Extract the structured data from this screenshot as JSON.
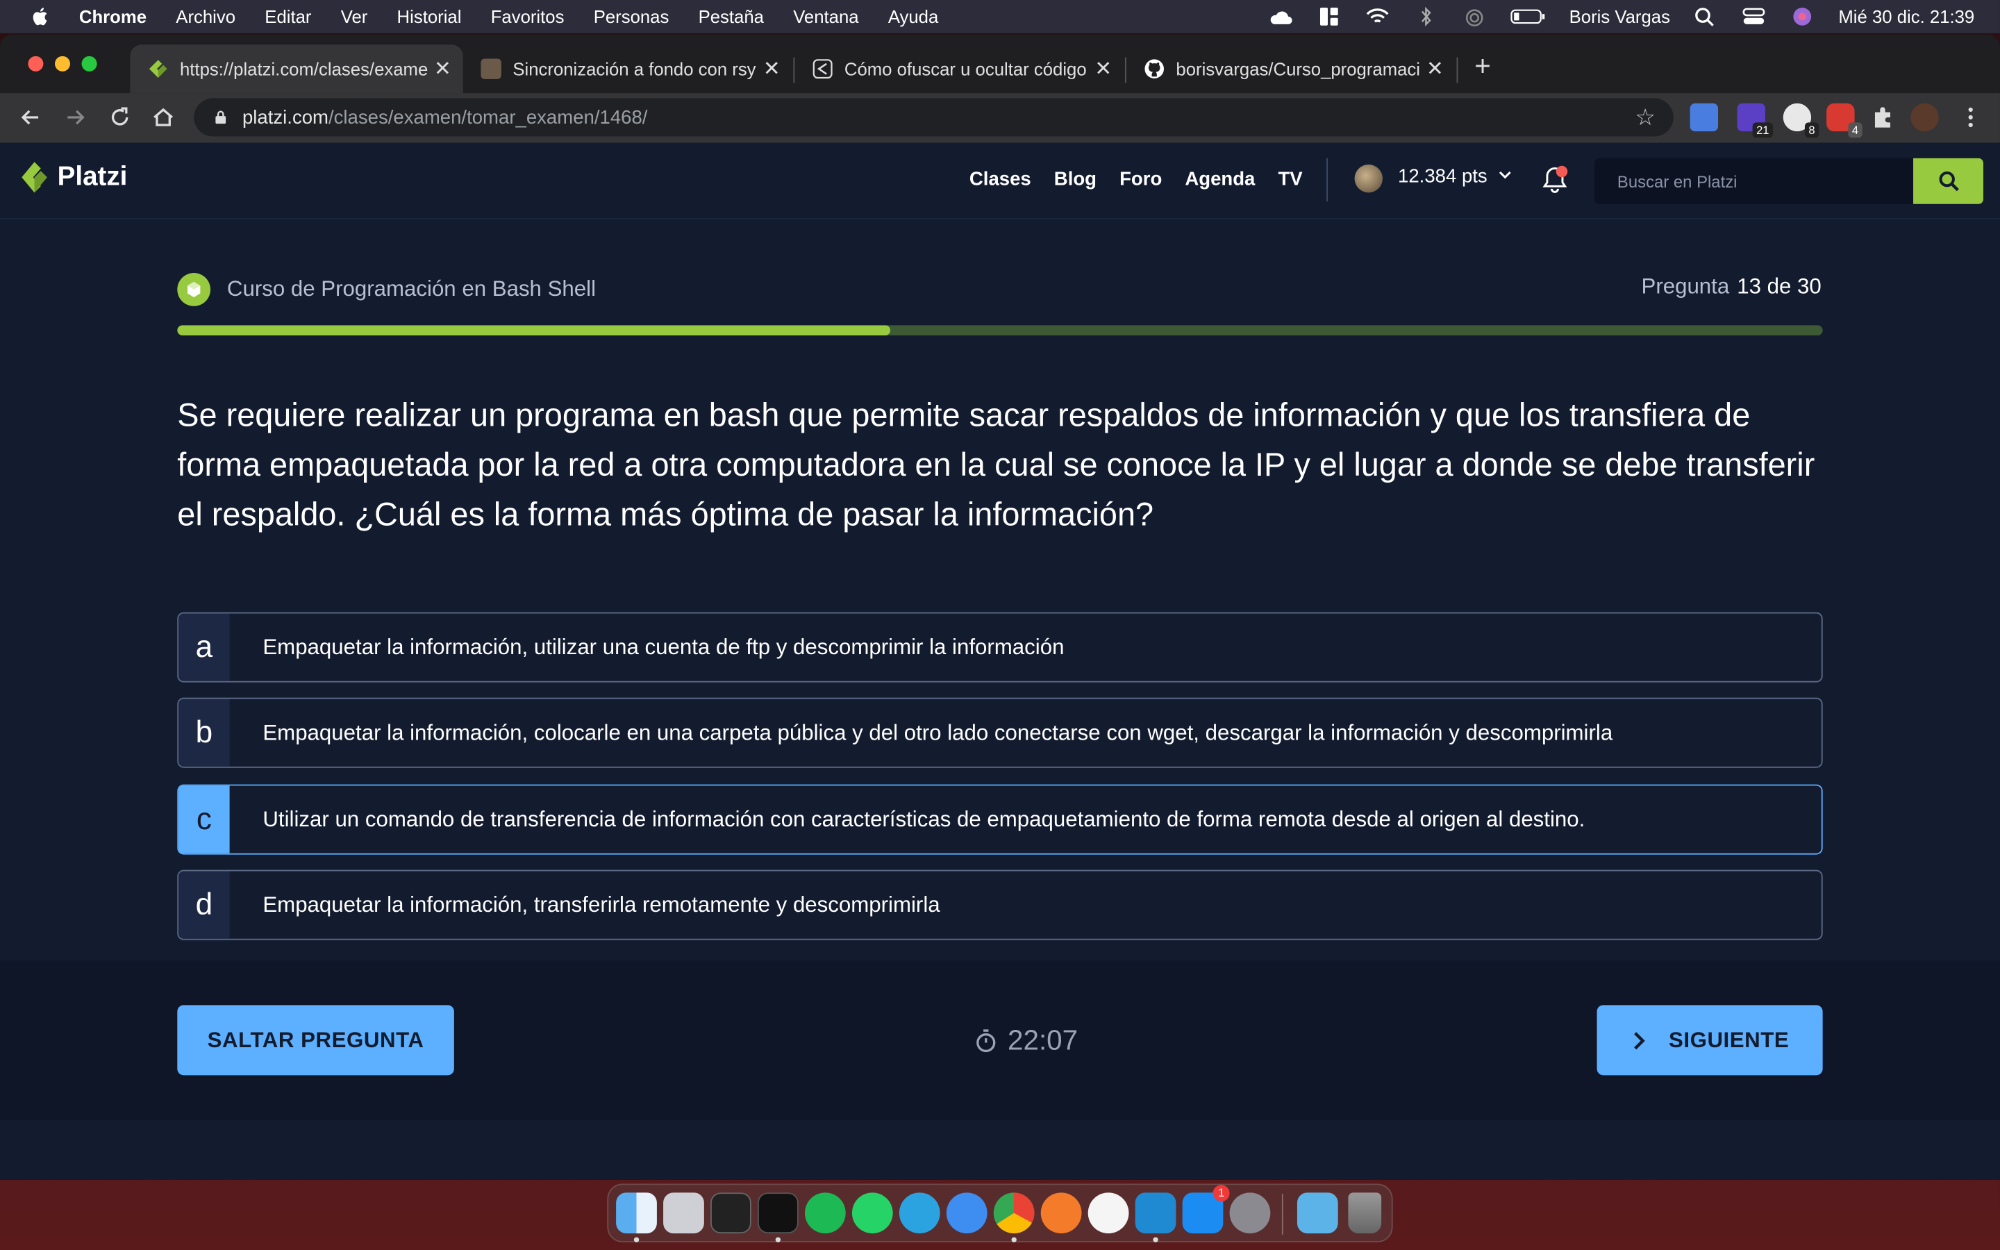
{
  "menubar": {
    "items": [
      "Chrome",
      "Archivo",
      "Editar",
      "Ver",
      "Historial",
      "Favoritos",
      "Personas",
      "Pestaña",
      "Ventana",
      "Ayuda"
    ],
    "user": "Boris Vargas",
    "datetime": "Mié 30 dic.  21:39"
  },
  "tabs": [
    {
      "title": "https://platzi.com/clases/exame"
    },
    {
      "title": "Sincronización a fondo con rsy"
    },
    {
      "title": "Cómo ofuscar u ocultar código"
    },
    {
      "title": "borisvargas/Curso_programaci"
    }
  ],
  "address": {
    "host": "platzi.com",
    "path": "/clases/examen/tomar_examen/1468/"
  },
  "extensions": {
    "badge1": "21",
    "badge2": "8",
    "badge3": "4"
  },
  "nav": {
    "logo": "Platzi",
    "links": [
      "Clases",
      "Blog",
      "Foro",
      "Agenda",
      "TV"
    ],
    "points": "12.384 pts",
    "search_placeholder": "Buscar en Platzi"
  },
  "exam": {
    "course": "Curso de Programación en Bash Shell",
    "question_label": "Pregunta",
    "question_count": "13 de 30",
    "progress": 0.433,
    "question": "Se requiere realizar un programa en bash que permite sacar respaldos de información y que los transfiera de forma empaquetada por la red a otra computadora en la cual se conoce la IP y el lugar a donde se debe transferir el respaldo. ¿Cuál es la forma más óptima de pasar la información?",
    "options": [
      {
        "letter": "a",
        "text": "Empaquetar la información, utilizar una cuenta de ftp y descomprimir la información"
      },
      {
        "letter": "b",
        "text": "Empaquetar la información, colocarle en una carpeta pública y del otro lado conectarse con wget, descargar la información y descomprimirla"
      },
      {
        "letter": "c",
        "text": "Utilizar un comando de transferencia de información con características de empaquetamiento de forma remota desde al origen al destino."
      },
      {
        "letter": "d",
        "text": "Empaquetar la información, transferirla remotamente y descomprimirla"
      }
    ],
    "selected": "c",
    "skip_label": "SALTAR PREGUNTA",
    "next_label": "SIGUIENTE",
    "timer": "22:07"
  },
  "colors": {
    "accent": "#98ca3f",
    "selected": "#5cb0ff",
    "background": "#131b2f"
  },
  "dock": {
    "appstore_badge": "1"
  }
}
